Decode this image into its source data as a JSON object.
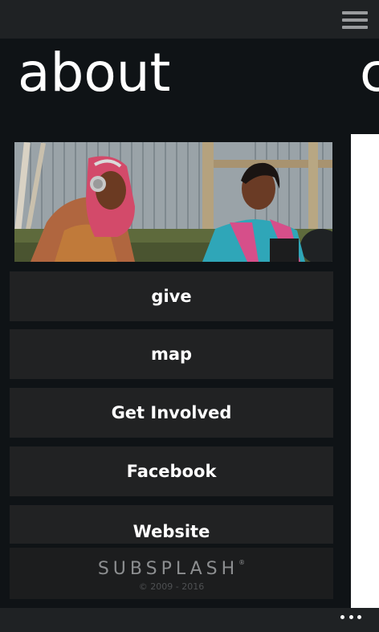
{
  "header": {
    "menu_icon": "hamburger-menu-icon"
  },
  "page": {
    "title": "about",
    "next_title": "c"
  },
  "hero": {
    "image": "photo of two women smiling"
  },
  "menu": {
    "items": [
      {
        "label": "give"
      },
      {
        "label": "map"
      },
      {
        "label": "Get Involved"
      },
      {
        "label": "Facebook"
      },
      {
        "label": "Website"
      }
    ]
  },
  "footer": {
    "brand": "SUBSPLASH",
    "trademark": "®",
    "copyright": "© 2009 - 2016"
  },
  "appbar": {
    "more_icon": "more-dots-icon"
  },
  "colors": {
    "background": "#0f1316",
    "button": "#212223",
    "bar": "#1f2224"
  }
}
